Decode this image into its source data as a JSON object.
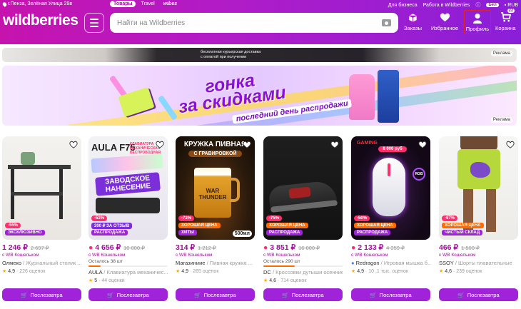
{
  "topbar": {
    "location": "г.Пенза, Зелёная Улица 29в",
    "tabs": [
      "Товары",
      "Travel",
      "wibes"
    ],
    "business": "Для бизнеса",
    "work": "Работа в Wildberries",
    "currency_pill": "Бел",
    "currency": "RUB"
  },
  "header": {
    "logo": "wildberries",
    "search_placeholder": "Найти на Wildberries",
    "nav": {
      "orders": "Заказы",
      "favorites": "Избранное",
      "profile": "Профиль",
      "cart": "Корзина",
      "cart_count": "22"
    }
  },
  "ad_strip": {
    "text_line1": "бесплатная курьерская доставка",
    "text_line2": "с оплатой при получении",
    "ad_label": "Реклама"
  },
  "promo": {
    "title_line1": "гонка",
    "title_line2": "за скидками",
    "subtitle": "последний день распродажи",
    "ad_label": "Реклама"
  },
  "products": [
    {
      "price": "1 246 ₽",
      "old_price": "2 697 ₽",
      "wallet": "с WB Кошельком",
      "brand": "Олмеко",
      "name": "/ Журнальный столик ...",
      "rating": "4,9",
      "reviews": "226 оценок",
      "discount": "-55%",
      "label": "ЭКСКЛЮЗИВНО",
      "label_color": "#a022d9",
      "buy": "Послезавтра"
    },
    {
      "price": "4 656 ₽",
      "old_price": "10 000 ₽",
      "wallet": "с WB Кошельком",
      "stock": "Осталось 38 шт",
      "stock_level": 0.15,
      "brand": "AULA",
      "name": "/ Клавиатура механичес...",
      "rating": "5",
      "reviews": "44 оценки",
      "discount": "-53%",
      "label": "РАСПРОДАЖА",
      "label_color": "#a022d9",
      "img_title": "AULA F75",
      "img_sub": "КЛАВИАТУРА МЕХАНИЧЕСКАЯ БЕСПРОВОДНАЯ",
      "img_banner": "ЗАВОДСКОЕ НАНЕСЕНИЕ",
      "img_promo": "200 ₽ ЗА ОТЗЫВ",
      "buy": "Послезавтра"
    },
    {
      "price": "314 ₽",
      "old_price": "1 212 ₽",
      "wallet": "с WB Кошельком",
      "brand": "Магазиниие",
      "name": "/ Пивная кружка ...",
      "rating": "4,9",
      "reviews": "265 оценок",
      "discount": "-73%",
      "label": "ХИТЫ",
      "label_color": "#a022d9",
      "label2": "ХОРОШАЯ ЦЕНА",
      "img_title": "КРУЖКА ПИВНАЯ",
      "img_sub": "С ГРАВИРОВКОЙ",
      "img_mug": "WAR THUNDER",
      "img_volume": "500мл",
      "buy": "Послезавтра"
    },
    {
      "price": "3 851 ₽",
      "old_price": "16 000 ₽",
      "wallet": "с WB Кошельком",
      "stock": "Осталось 290 шт",
      "stock_level": 0.4,
      "brand": "DC",
      "name": "/ Кроссовки дутыши осенние ...",
      "rating": "4,6",
      "reviews": "714 оценок",
      "discount": "-75%",
      "label": "РАСПРОДАЖА",
      "label_color": "#a022d9",
      "label2": "ХОРОШАЯ ЦЕНА",
      "buy": "Послезавтра"
    },
    {
      "price": "2 133 ₽",
      "old_price": "4 359 ₽",
      "wallet": "с WB Кошельком",
      "brand": "Redragon",
      "name": "/ Игровая мышка б...",
      "rating": "4,9",
      "reviews": "10 ,1 тыс. оценок",
      "discount": "-50%",
      "label": "РАСПРОДАЖА",
      "label_color": "#a022d9",
      "label2": "ХОРОШАЯ ЦЕНА",
      "img_brand": "GAMING",
      "img_price": "8 000 руб",
      "img_rgb": "RGB",
      "buy": "Послезавтра"
    },
    {
      "price": "466 ₽",
      "old_price": "1 500 ₽",
      "wallet": "с WB Кошельком",
      "brand": "SSOY",
      "name": "/ Шорты плавательные",
      "rating": "4,6",
      "reviews": "239 оценок",
      "discount": "-67%",
      "label": "ЧИСТЫЙ СКЛАД",
      "label_color": "#a022d9",
      "label2": "ХОРОШАЯ ЦЕНА",
      "buy": "Послезавтра"
    }
  ]
}
